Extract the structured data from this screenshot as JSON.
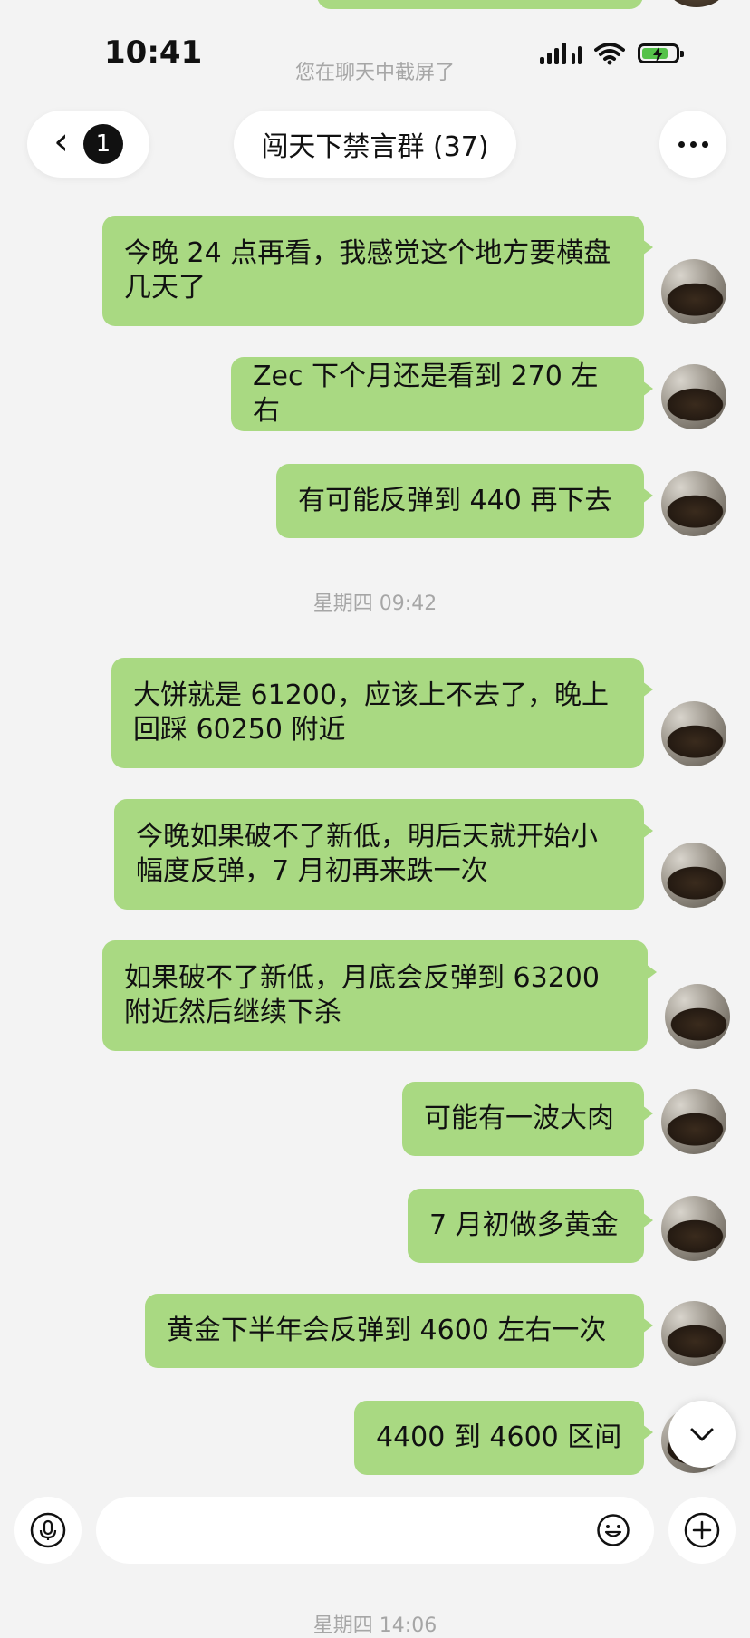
{
  "status_bar": {
    "time": "10:41",
    "screenshot_notice": "您在聊天中截屏了"
  },
  "header": {
    "unread_count": "1",
    "title": "闯天下禁言群 (37)"
  },
  "messages": [
    {
      "text": "今晚 24 点再看，我感觉这个地方要横盘几天了"
    },
    {
      "text": "Zec 下个月还是看到 270 左右"
    },
    {
      "text": "有可能反弹到 440 再下去"
    },
    {
      "timestamp": "星期四 09:42"
    },
    {
      "text": "大饼就是 61200，应该上不去了，晚上回踩 60250 附近"
    },
    {
      "text": "今晚如果破不了新低，明后天就开始小幅度反弹，7 月初再来跌一次"
    },
    {
      "text": "如果破不了新低，月底会反弹到 63200 附近然后继续下杀"
    },
    {
      "text": "可能有一波大肉"
    },
    {
      "text": "7 月初做多黄金"
    },
    {
      "text": "黄金下半年会反弹到 4600 左右一次"
    },
    {
      "text": "4400 到 4600 区间"
    }
  ],
  "bottom_timestamp": "星期四 14:06",
  "colors": {
    "background": "#f3f3f3",
    "bubble_green": "#a9d982",
    "muted_text": "#a6a6a6"
  }
}
